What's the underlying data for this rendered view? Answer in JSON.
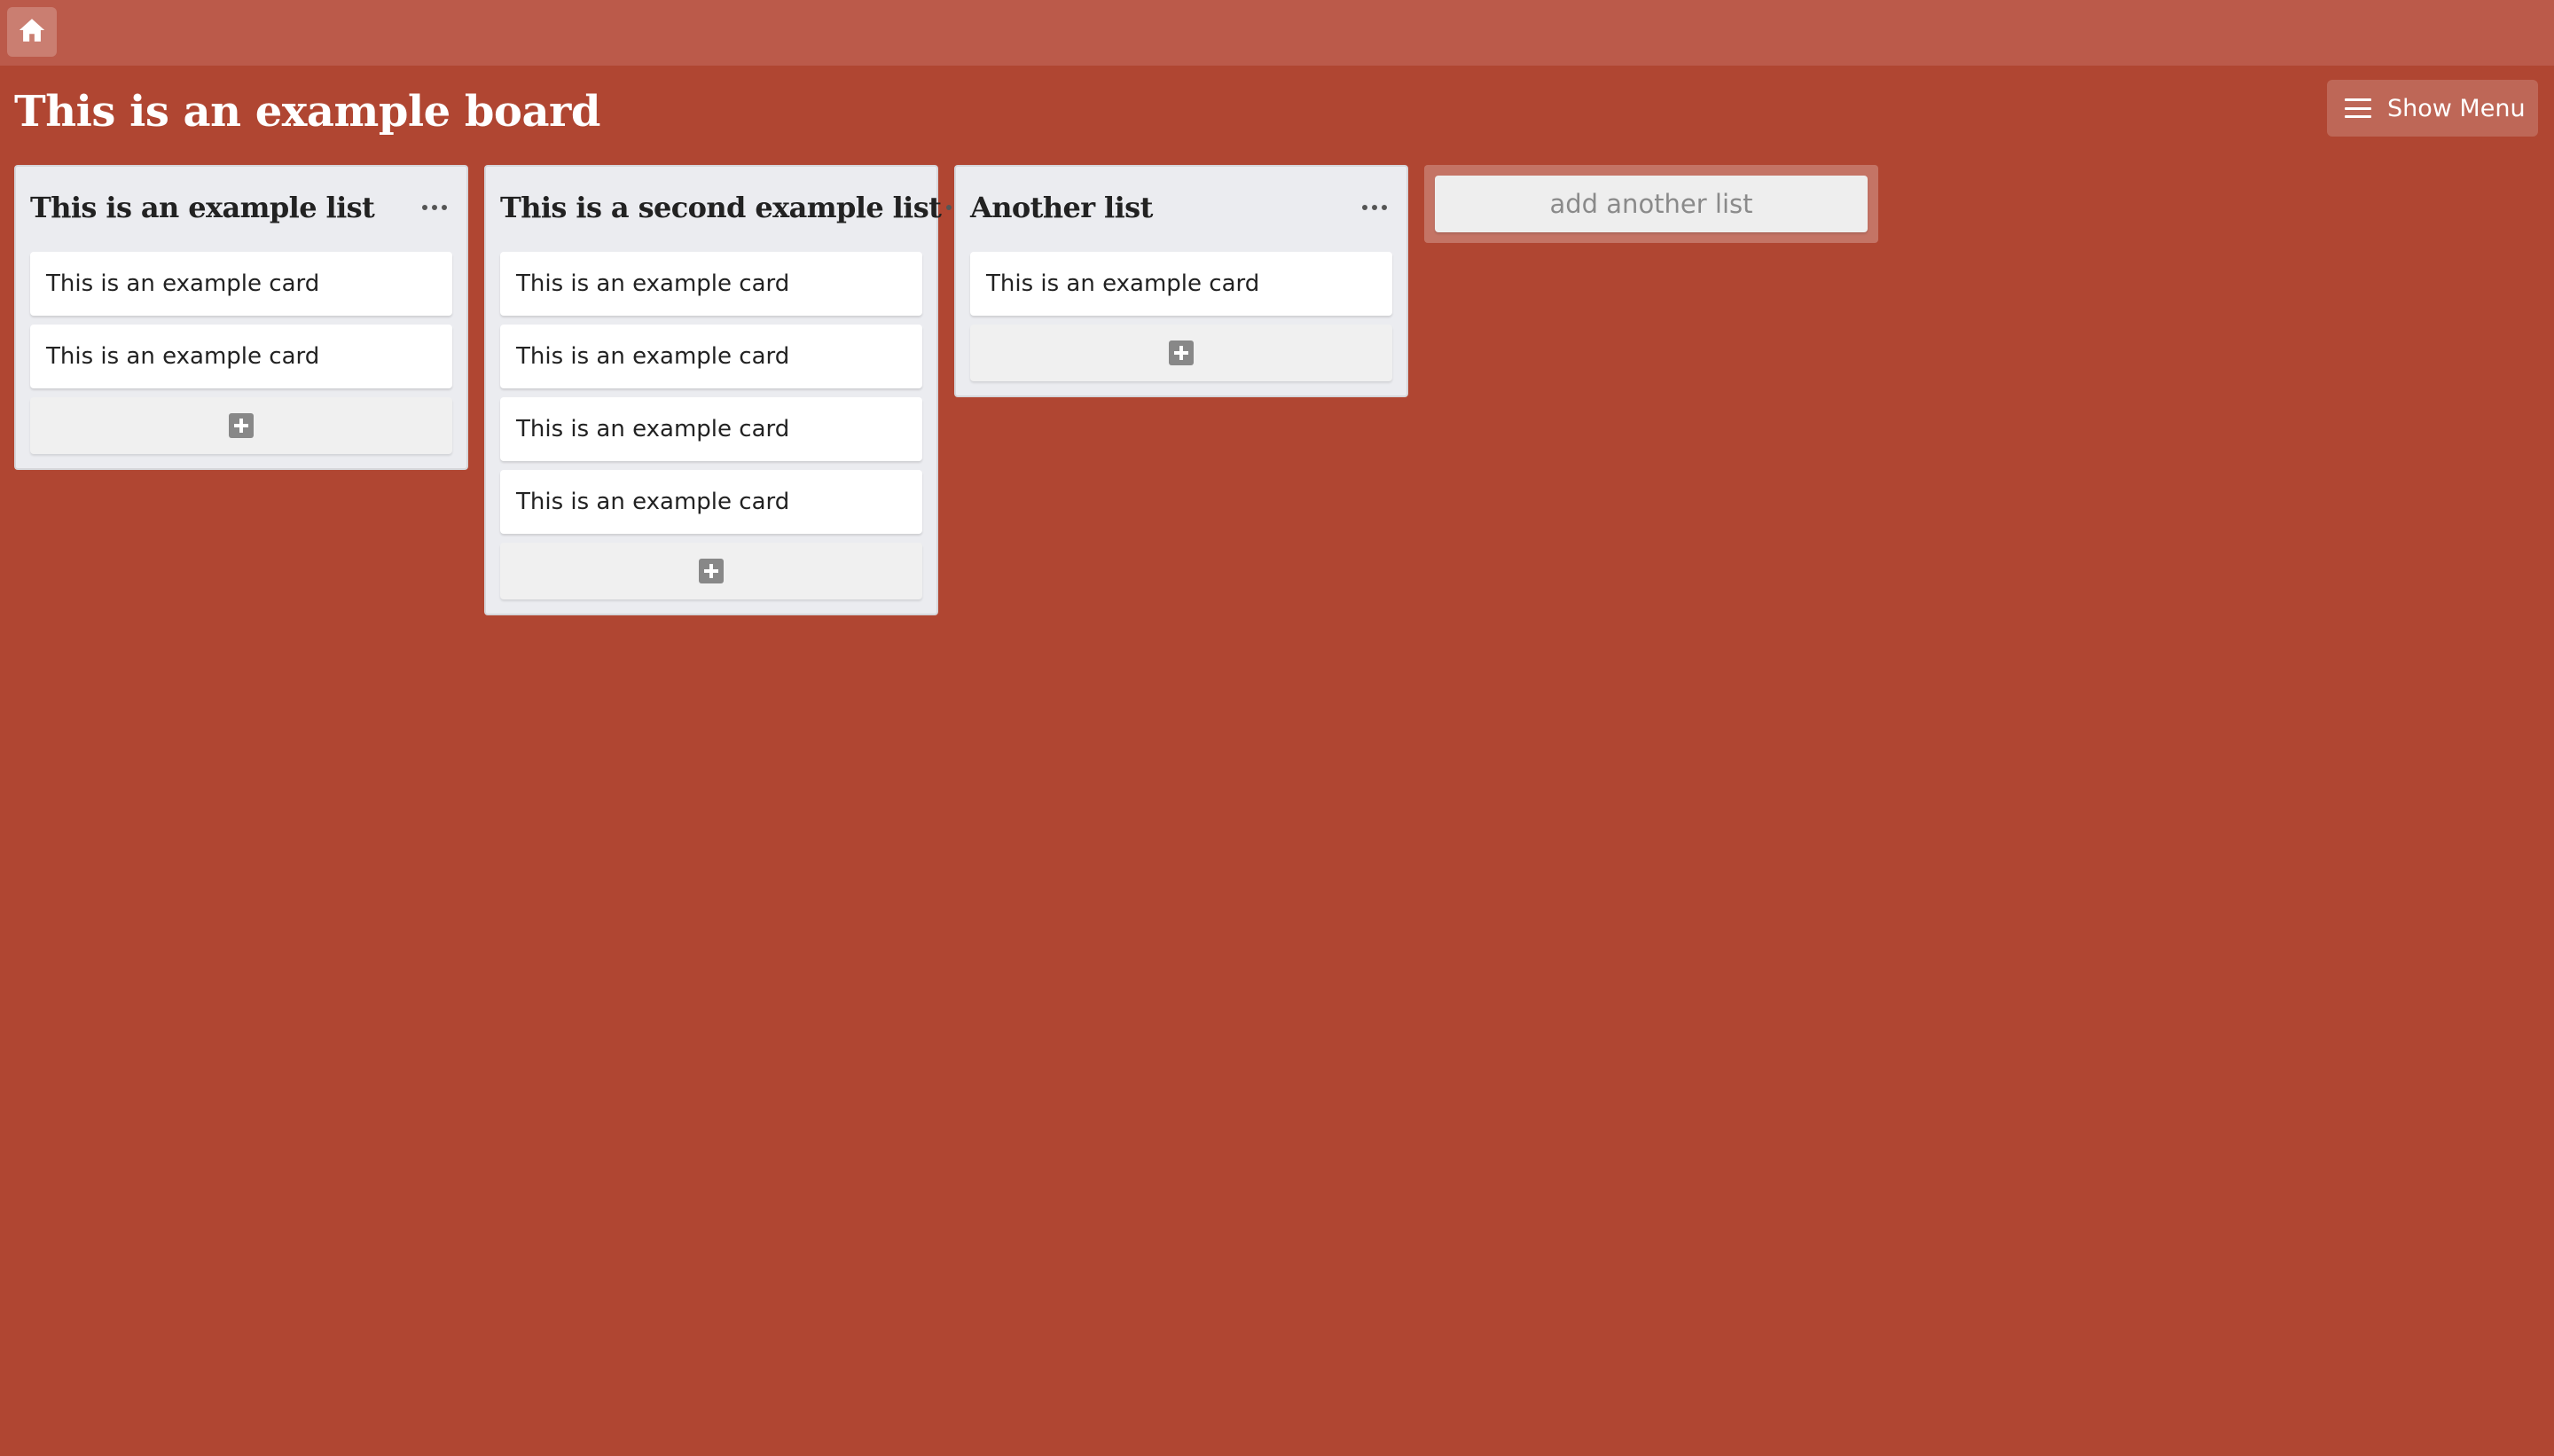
{
  "topbar": {
    "home_icon": "home-icon"
  },
  "board": {
    "title": "This is an example board",
    "menu_label": "Show Menu",
    "menu_icon": "hamburger-icon",
    "background_color": "#b04632"
  },
  "lists": [
    {
      "title": "This is an example list",
      "cards": [
        "This is an example card",
        "This is an example card"
      ]
    },
    {
      "title": "This is a second example list",
      "cards": [
        "This is an example card",
        "This is an example card",
        "This is an example card",
        "This is an example card"
      ]
    },
    {
      "title": "Another list",
      "cards": [
        "This is an example card"
      ]
    }
  ],
  "add_list_label": "add another list"
}
